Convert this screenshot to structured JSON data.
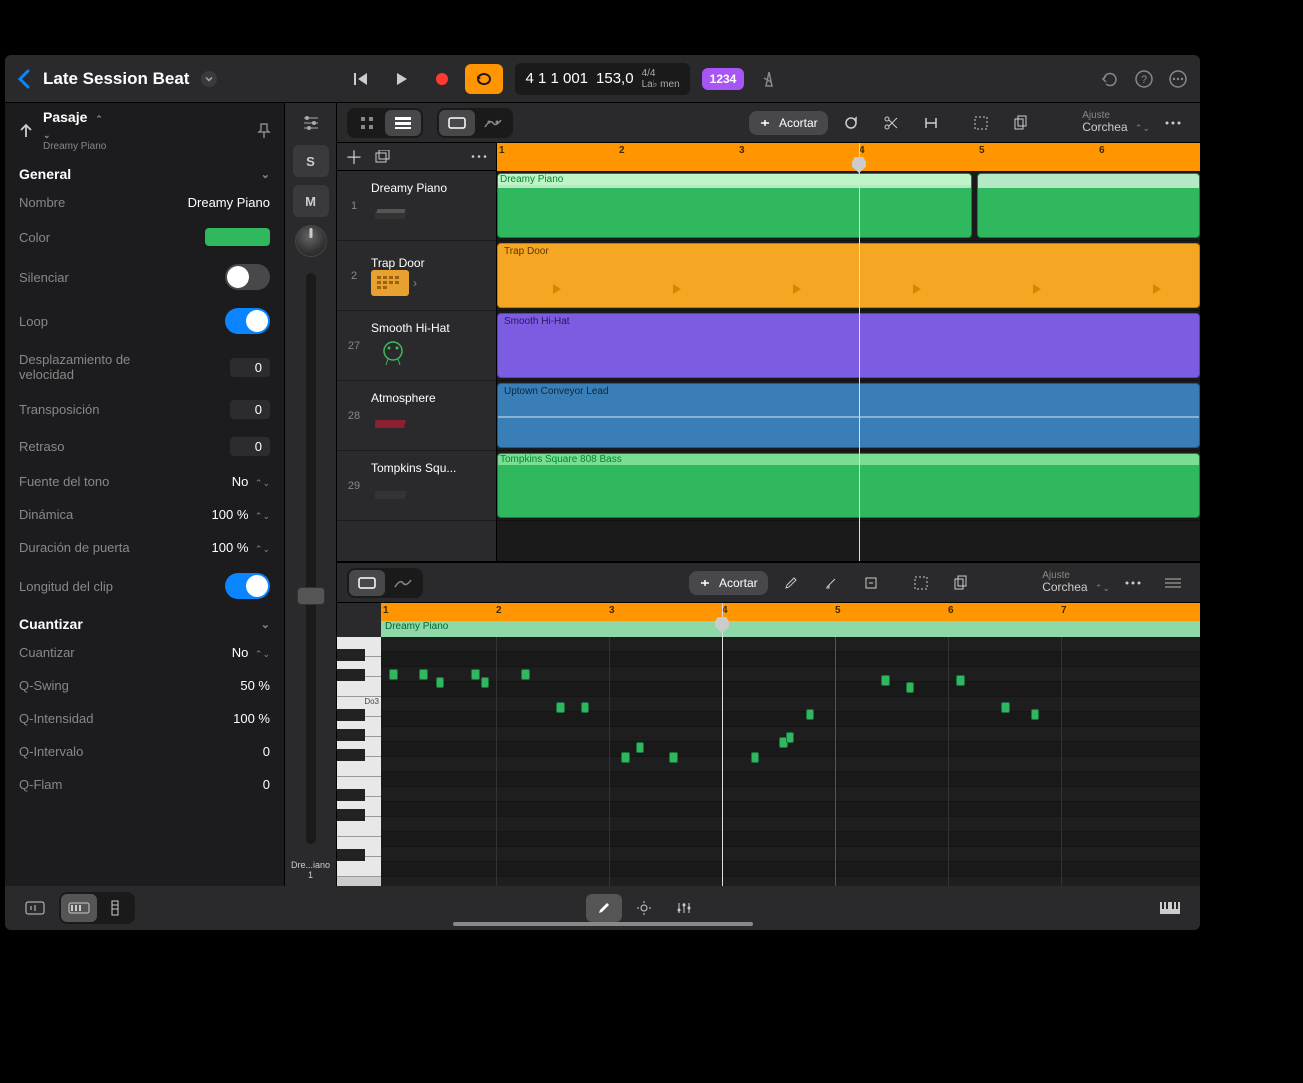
{
  "header": {
    "project_title": "Late Session Beat",
    "lcd_position": "4 1 1 001",
    "lcd_tempo": "153,0",
    "lcd_sig": "4/4",
    "lcd_key": "La♭ men",
    "mode_badge": "1234"
  },
  "inspector": {
    "section_label": "Pasaje",
    "subtitle": "Dreamy Piano",
    "general_label": "General",
    "rows": {
      "nombre_label": "Nombre",
      "nombre_val": "Dreamy Piano",
      "color_label": "Color",
      "color_val": "#2fb85e",
      "silenciar_label": "Silenciar",
      "loop_label": "Loop",
      "desplaz_label": "Desplazamiento de velocidad",
      "desplaz_val": "0",
      "transp_label": "Transposición",
      "transp_val": "0",
      "retraso_label": "Retraso",
      "retraso_val": "0",
      "fuente_label": "Fuente del tono",
      "fuente_val": "No",
      "dinamica_label": "Dinámica",
      "dinamica_val": "100 %",
      "duracion_label": "Duración de puerta",
      "duracion_val": "100 %",
      "longitud_label": "Longitud del clip"
    },
    "quantize_label": "Cuantizar",
    "q_rows": {
      "cuantizar_label": "Cuantizar",
      "cuantizar_val": "No",
      "qswing_label": "Q-Swing",
      "qswing_val": "50 %",
      "qintens_label": "Q-Intensidad",
      "qintens_val": "100 %",
      "qinterv_label": "Q-Intervalo",
      "qinterv_val": "0",
      "qflam_label": "Q-Flam",
      "qflam_val": "0"
    }
  },
  "mixer": {
    "solo": "S",
    "mute": "M",
    "label": "Dre...iano",
    "label_num": "1"
  },
  "tracks_toolbar": {
    "tool_label": "Acortar",
    "snap_label": "Ajuste",
    "snap_val": "Corchea"
  },
  "tracks": [
    {
      "num": "1",
      "name": "Dreamy Piano",
      "color": "#2fb85e",
      "region_label": "Dreamy Piano"
    },
    {
      "num": "2",
      "name": "Trap Door",
      "color": "#f5a623",
      "region_label": "Trap Door"
    },
    {
      "num": "27",
      "name": "Smooth Hi-Hat",
      "color": "#7c5ce0",
      "region_label": "Smooth Hi-Hat"
    },
    {
      "num": "28",
      "name": "Atmosphere",
      "color": "#3a7eb8",
      "region_label": "Uptown Conveyor Lead"
    },
    {
      "num": "29",
      "name": "Tompkins Squ...",
      "color": "#2fb85e",
      "region_label": "Tompkins Square 808 Bass"
    }
  ],
  "ruler_marks": [
    "1",
    "2",
    "3",
    "4",
    "5",
    "6"
  ],
  "editor": {
    "tool_label": "Acortar",
    "snap_label": "Ajuste",
    "snap_val": "Corchea",
    "region_label": "Dreamy Piano",
    "key_label": "Do3",
    "ruler_marks": [
      "1",
      "2",
      "3",
      "4",
      "5",
      "6",
      "7"
    ]
  }
}
